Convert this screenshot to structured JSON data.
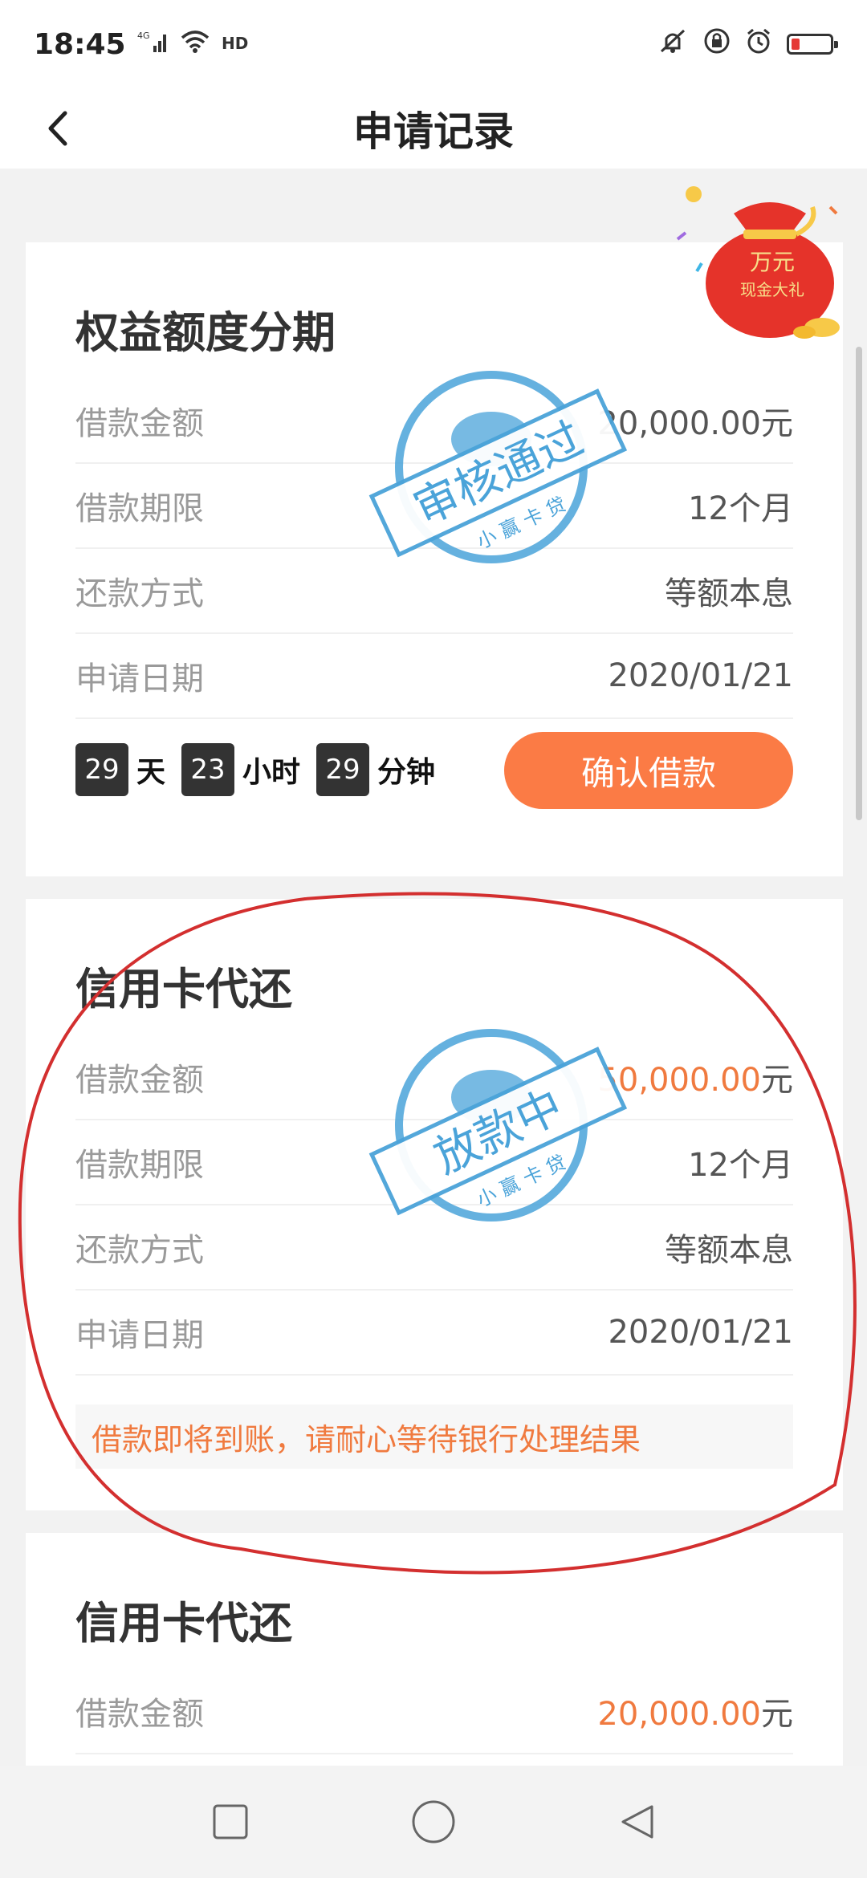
{
  "status_bar": {
    "time": "18:45",
    "network_label": "4G",
    "hd_label": "HD"
  },
  "nav": {
    "title": "申请记录"
  },
  "promo": {
    "line1": "万元",
    "line2": "现金大礼"
  },
  "cards": [
    {
      "title": "权益额度分期",
      "rows": [
        {
          "label": "借款金额",
          "value": "20,000.00",
          "unit": "元"
        },
        {
          "label": "借款期限",
          "value": "12个月"
        },
        {
          "label": "还款方式",
          "value": "等额本息"
        },
        {
          "label": "申请日期",
          "value": "2020/01/21"
        }
      ],
      "stamp": {
        "main": "审核通过",
        "sub": "小 赢 卡 贷"
      },
      "countdown": {
        "days": "29",
        "days_unit": "天",
        "hours": "23",
        "hours_unit": "小时",
        "minutes": "29",
        "minutes_unit": "分钟"
      },
      "button": "确认借款"
    },
    {
      "title": "信用卡代还",
      "rows": [
        {
          "label": "借款金额",
          "value": "50,000.00",
          "unit": "元"
        },
        {
          "label": "借款期限",
          "value": "12个月"
        },
        {
          "label": "还款方式",
          "value": "等额本息"
        },
        {
          "label": "申请日期",
          "value": "2020/01/21"
        }
      ],
      "stamp": {
        "main": "放款中",
        "sub": "小 赢 卡 贷"
      },
      "notice": "借款即将到账，请耐心等待银行处理结果"
    },
    {
      "title": "信用卡代还",
      "rows": [
        {
          "label": "借款金额",
          "value": "20,000.00",
          "unit": "元"
        }
      ]
    }
  ],
  "colors": {
    "accent_orange": "#fb7b45",
    "amount_orange": "#f07a3f",
    "stamp_blue": "#4aa3d9",
    "annotation_red": "#d32f2f"
  }
}
